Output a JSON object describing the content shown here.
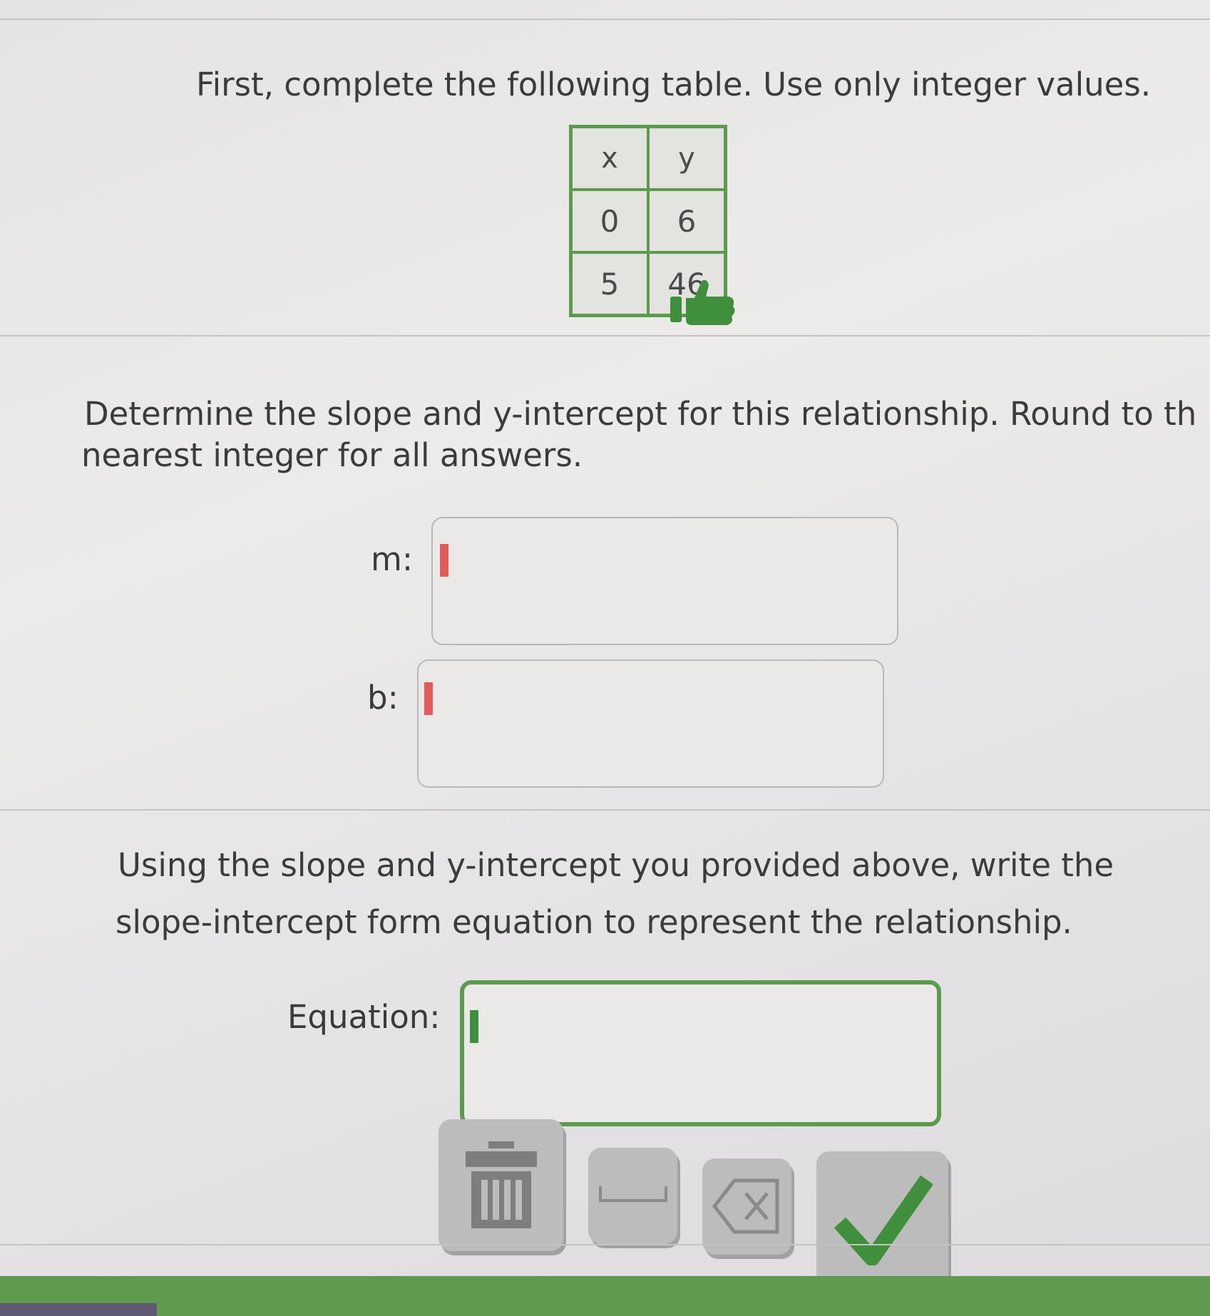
{
  "section1": {
    "instruction": "First, complete the following table. Use only integer values.",
    "table": {
      "headers": [
        "x",
        "y"
      ],
      "rows": [
        [
          "0",
          "6"
        ],
        [
          "5",
          "46"
        ]
      ]
    },
    "feedback_icon": "thumbs-up-icon",
    "feedback_color": "#3f8f3c"
  },
  "section2": {
    "instruction_line1": "Determine the slope and y-intercept for this relationship. Round to th",
    "instruction_line2": "nearest integer for all answers.",
    "m_label": "m:",
    "m_value": "",
    "b_label": "b:",
    "b_value": ""
  },
  "section3": {
    "instruction_line1": "Using the slope and y-intercept you provided above, write the",
    "instruction_line2": "slope-intercept form equation to represent the relationship.",
    "equation_label": "Equation:",
    "equation_value": ""
  },
  "keypad": {
    "keys": [
      "trash-icon",
      "space-icon",
      "backspace-icon",
      "checkmark-icon"
    ],
    "accent": "#3f8f3c"
  },
  "colors": {
    "accent": "#5c9a4d",
    "error_cursor": "#e25a5a"
  }
}
